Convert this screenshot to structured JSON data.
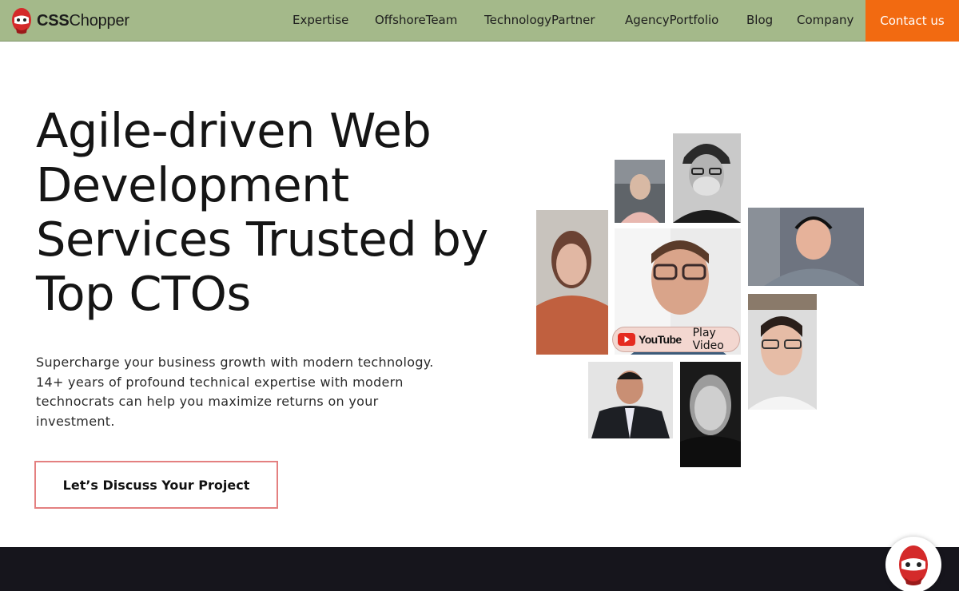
{
  "brand": {
    "name_bold": "CSS",
    "name_rest": "Chopper",
    "logo_icon": "ninja-mascot-icon"
  },
  "nav": {
    "items": [
      {
        "label": "Expertise"
      },
      {
        "label": "OffshoreTeam"
      },
      {
        "label": "TechnologyPartner"
      },
      {
        "label": "AgencyPortfolio"
      },
      {
        "label": "Blog"
      },
      {
        "label": "Company"
      }
    ],
    "contact_label": "Contact us"
  },
  "hero": {
    "title": "Agile-driven Web Development Services Trusted by Top CTOs",
    "subtitle": "Supercharge your business growth with modern technology. 14+ years of profound technical expertise with modern technocrats can help you maximize returns on your investment.",
    "cta_label": "Let’s Discuss Your Project"
  },
  "video": {
    "youtube_text": "YouTube",
    "play_label": "Play Video",
    "youtube_icon": "youtube-play-icon"
  },
  "chat_widget": {
    "icon": "ninja-chat-icon"
  },
  "colors": {
    "header_bg": "#a4b98a",
    "contact_bg": "#f26a11",
    "cta_border": "#e48080",
    "footer_band": "#16151c"
  }
}
